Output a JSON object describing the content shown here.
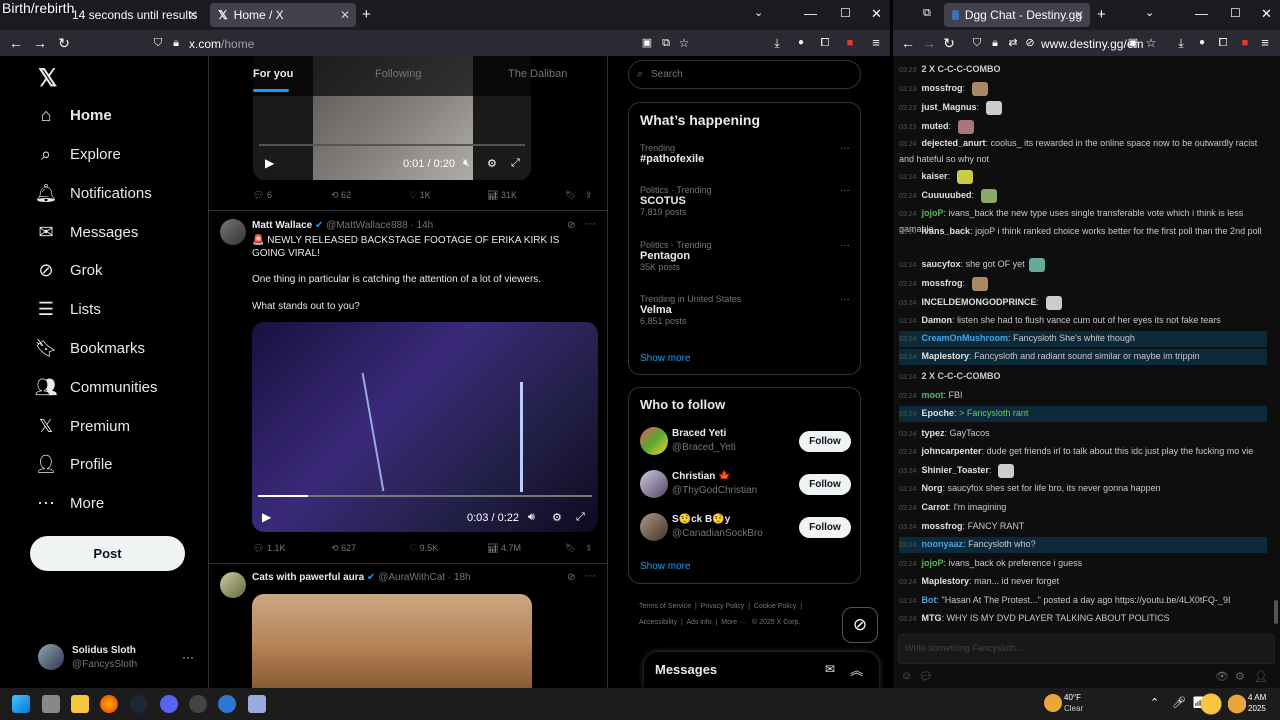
{
  "overlay_text": "Birth/rebirth",
  "left_browser": {
    "tabs": [
      {
        "label": "14 seconds until results"
      },
      {
        "label": "Home / X"
      }
    ],
    "url_main": "x.com",
    "url_path": "/home"
  },
  "x_sidebar": {
    "items": [
      {
        "label": "Home",
        "icon": "home-icon"
      },
      {
        "label": "Explore",
        "icon": "search-icon"
      },
      {
        "label": "Notifications",
        "icon": "bell-icon"
      },
      {
        "label": "Messages",
        "icon": "mail-icon"
      },
      {
        "label": "Grok",
        "icon": "grok-icon"
      },
      {
        "label": "Lists",
        "icon": "list-icon"
      },
      {
        "label": "Bookmarks",
        "icon": "bookmark-icon"
      },
      {
        "label": "Communities",
        "icon": "people-icon"
      },
      {
        "label": "Premium",
        "icon": "x-logo-icon"
      },
      {
        "label": "Profile",
        "icon": "person-icon"
      },
      {
        "label": "More",
        "icon": "more-circle-icon"
      }
    ],
    "post_label": "Post",
    "account_name": "Solidus Sloth",
    "account_handle": "@FancysSloth"
  },
  "timeline": {
    "tabs": [
      "For you",
      "Following",
      "The Daliban"
    ],
    "video1": {
      "time": "0:01 / 0:20"
    },
    "post1_stats": {
      "replies": "6",
      "reposts": "62",
      "likes": "1K",
      "views": "31K"
    },
    "post2": {
      "author": "Matt Wallace",
      "handle": "@MattWallace888",
      "time": "· 14h",
      "line1": "🚨 NEWLY RELEASED BACKSTAGE FOOTAGE OF ERIKA KIRK IS GOING VIRAL!",
      "line2": "One thing in particular is catching the attention of a lot of viewers.",
      "line3": "What stands out to you?",
      "video_time": "0:03 / 0:22",
      "stats": {
        "replies": "1.1K",
        "reposts": "627",
        "likes": "9.5K",
        "views": "4.7M"
      }
    },
    "post3": {
      "author": "Cats with pawerful aura",
      "handle": "@AuraWithCat",
      "time": "· 18h"
    }
  },
  "right_column": {
    "search_placeholder": "Search",
    "happening_title": "What’s happening",
    "trends": [
      {
        "category": "Trending",
        "name": "#pathofexile",
        "count": ""
      },
      {
        "category": "Politics · Trending",
        "name": "SCOTUS",
        "count": "7,819 posts"
      },
      {
        "category": "Politics · Trending",
        "name": "Pentagon",
        "count": "35K posts"
      },
      {
        "category": "Trending in United States",
        "name": "Velma",
        "count": "6,851 posts"
      }
    ],
    "show_more": "Show more",
    "follow_title": "Who to follow",
    "follow": [
      {
        "name": "Braced Yeti",
        "handle": "@Braced_Yeti",
        "btn": "Follow"
      },
      {
        "name": "Christian 🍁",
        "handle": "@ThyGodChristian",
        "btn": "Follow"
      },
      {
        "name": "S🤨ck B🤨y",
        "handle": "@CanadianSockBro",
        "btn": "Follow"
      }
    ],
    "footer": [
      "Terms of Service",
      "Privacy Policy",
      "Cookie Policy",
      "Accessibility",
      "Ads info",
      "More ···",
      "© 2025 X Corp."
    ],
    "messages_label": "Messages"
  },
  "right_browser": {
    "tab_label": "Dgg Chat - Destiny.gg",
    "url": "www.destiny.gg/em",
    "input_placeholder": "Write something Fancysloth...",
    "messages": [
      {
        "time": "03:23",
        "user": "",
        "text": "2 X C-C-C-COMBO"
      },
      {
        "time": "03:23",
        "user": "mossfrog",
        "text": ""
      },
      {
        "time": "03:23",
        "user": "just_Magnus",
        "text": ""
      },
      {
        "time": "03:23",
        "user": "muted",
        "text": ""
      },
      {
        "time": "03:24",
        "user": "dejected_anurt",
        "text": "coolus_ its rewarded in the online space now to be outwardly racist and hateful so why not"
      },
      {
        "time": "03:24",
        "user": "kaiser",
        "text": ""
      },
      {
        "time": "03:24",
        "user": "Cuuuuubed",
        "text": ""
      },
      {
        "time": "03:24",
        "user": "jojoP",
        "text": "ivans_back the new type uses single transferable vote which i think is less gamable"
      },
      {
        "time": "03:24",
        "user": "ivans_back",
        "text": "jojoP i think ranked choice works better for the first poll than the 2nd poll"
      },
      {
        "time": "03:24",
        "user": "saucyfox",
        "text": "she got OF yet"
      },
      {
        "time": "03:24",
        "user": "mossfrog",
        "text": ""
      },
      {
        "time": "03:24",
        "user": "INCELDEMONGODPRINCE",
        "text": ""
      },
      {
        "time": "03:24",
        "user": "Damon",
        "text": "listen she had to flush vance cum out of her eyes     its not fake tears"
      },
      {
        "time": "03:24",
        "user": "CreamOnMushroom",
        "text": "Fancysloth She's white though"
      },
      {
        "time": "03:24",
        "user": "Maplestory",
        "text": "Fancysloth and radiant sound similar     or maybe im trippin"
      },
      {
        "time": "03:24",
        "user": "",
        "text": "2 X C-C-C-COMBO"
      },
      {
        "time": "03:24",
        "user": "moot",
        "text": "FBI"
      },
      {
        "time": "03:24",
        "user": "Epoche",
        "text": "> Fancysloth rant"
      },
      {
        "time": "03:24",
        "user": "typez",
        "text": "GayTacos"
      },
      {
        "time": "03:24",
        "user": "johncarpenter",
        "text": "dude get friends irl to talk about this idc just play the fucking mo vie"
      },
      {
        "time": "03:24",
        "user": "Shinier_Toaster",
        "text": ""
      },
      {
        "time": "03:24",
        "user": "Norg",
        "text": "saucyfox shes set for life bro, its never gonna happen"
      },
      {
        "time": "03:24",
        "user": "Carrot",
        "text": "I'm imagining"
      },
      {
        "time": "03:24",
        "user": "mossfrog",
        "text": "FANCY RANT"
      },
      {
        "time": "03:24",
        "user": "noonyaaz",
        "text": "Fancysloth who?"
      },
      {
        "time": "03:24",
        "user": "jojoP",
        "text": "ivans_back ok     preference i guess"
      },
      {
        "time": "03:24",
        "user": "Maplestory",
        "text": "man... id never forget"
      },
      {
        "time": "03:24",
        "user": "Bot",
        "text": "\"Hasan At The Protest...\" posted a day ago https://youtu.be/4LX0tFQ-_9I"
      },
      {
        "time": "03:24",
        "user": "MTG",
        "text": "WHY IS MY DVD PLAYER TALKING ABOUT POLITICS"
      }
    ]
  },
  "taskbar": {
    "weather_temp": "40°F",
    "weather_desc": "Clear",
    "clock_time": "4 AM",
    "clock_year": "2025"
  }
}
